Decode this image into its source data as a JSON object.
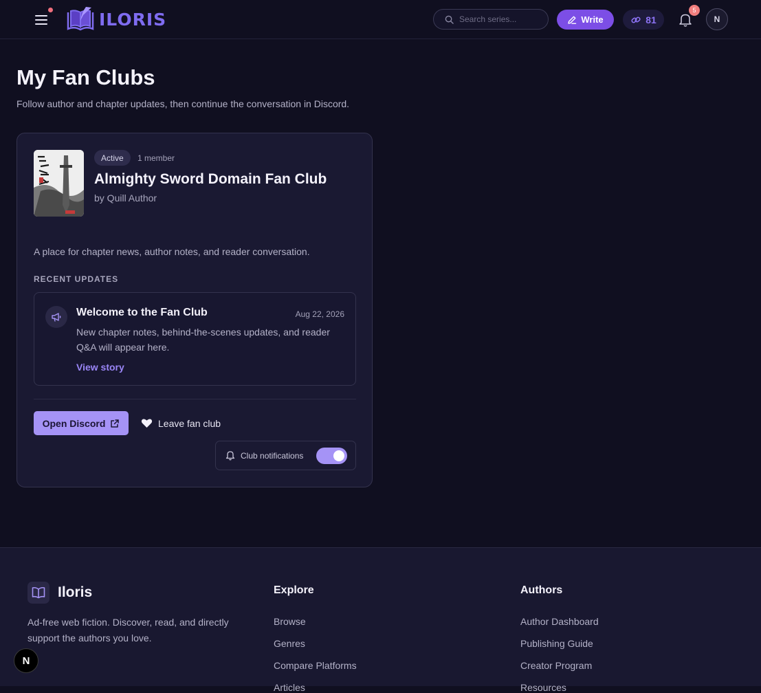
{
  "header": {
    "brand": "ILORIS",
    "search_placeholder": "Search series...",
    "write_label": "Write",
    "points_value": "81",
    "notification_count": "5",
    "avatar_initial": "N"
  },
  "page": {
    "title": "My Fan Clubs",
    "subtitle": "Follow author and chapter updates, then continue the conversation in Discord."
  },
  "club": {
    "status_badge": "Active",
    "member_count": "1 member",
    "title": "Almighty Sword Domain Fan Club",
    "author": "by Quill Author",
    "description": "A place for chapter news, author notes, and reader conversation.",
    "section_label": "RECENT UPDATES",
    "update": {
      "title": "Welcome to the Fan Club",
      "date": "Aug 22, 2026",
      "body": "New chapter notes, behind-the-scenes updates, and reader Q&A will appear here.",
      "link": "View story"
    },
    "discord_button": "Open Discord",
    "leave_button": "Leave fan club",
    "notifications_label": "Club notifications",
    "notifications_on": true
  },
  "footer": {
    "brand": "Iloris",
    "tagline": "Ad-free web fiction. Discover, read, and directly support the authors you love.",
    "columns": [
      {
        "title": "Explore",
        "links": [
          "Browse",
          "Genres",
          "Compare Platforms",
          "Articles"
        ]
      },
      {
        "title": "Authors",
        "links": [
          "Author Dashboard",
          "Publishing Guide",
          "Creator Program",
          "Resources"
        ]
      }
    ]
  },
  "dev_badge": "N",
  "colors": {
    "background": "#100f20",
    "accent": "#7c4ee6",
    "accent_light": "#a593f6",
    "card": "#1a1932"
  }
}
